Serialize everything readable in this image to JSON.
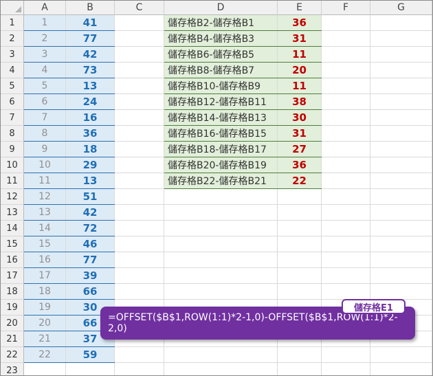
{
  "columns": [
    "A",
    "B",
    "C",
    "D",
    "E",
    "F",
    "G"
  ],
  "rows": [
    "1",
    "2",
    "3",
    "4",
    "5",
    "6",
    "7",
    "8",
    "9",
    "10",
    "11",
    "12",
    "13",
    "14",
    "15",
    "16",
    "17",
    "18",
    "19",
    "20",
    "21",
    "22",
    "23"
  ],
  "colA": [
    "1",
    "2",
    "3",
    "4",
    "5",
    "6",
    "7",
    "8",
    "9",
    "10",
    "11",
    "12",
    "13",
    "14",
    "15",
    "16",
    "17",
    "18",
    "19",
    "20",
    "21",
    "22"
  ],
  "colB": [
    "41",
    "77",
    "42",
    "73",
    "13",
    "24",
    "16",
    "36",
    "18",
    "29",
    "13",
    "51",
    "42",
    "72",
    "46",
    "77",
    "39",
    "66",
    "30",
    "66",
    "37",
    "59"
  ],
  "colD": [
    "儲存格B2-儲存格B1",
    "儲存格B4-儲存格B3",
    "儲存格B6-儲存格B5",
    "儲存格B8-儲存格B7",
    "儲存格B10-儲存格B9",
    "儲存格B12-儲存格B11",
    "儲存格B14-儲存格B13",
    "儲存格B16-儲存格B15",
    "儲存格B18-儲存格B17",
    "儲存格B20-儲存格B19",
    "儲存格B22-儲存格B21"
  ],
  "colE": [
    "36",
    "31",
    "11",
    "20",
    "11",
    "38",
    "30",
    "31",
    "27",
    "36",
    "22"
  ],
  "callout": {
    "label": "儲存格E1",
    "formula": "=OFFSET($B$1,ROW(1:1)*2-1,0)-OFFSET($B$1,ROW(1:1)*2-2,0)"
  }
}
